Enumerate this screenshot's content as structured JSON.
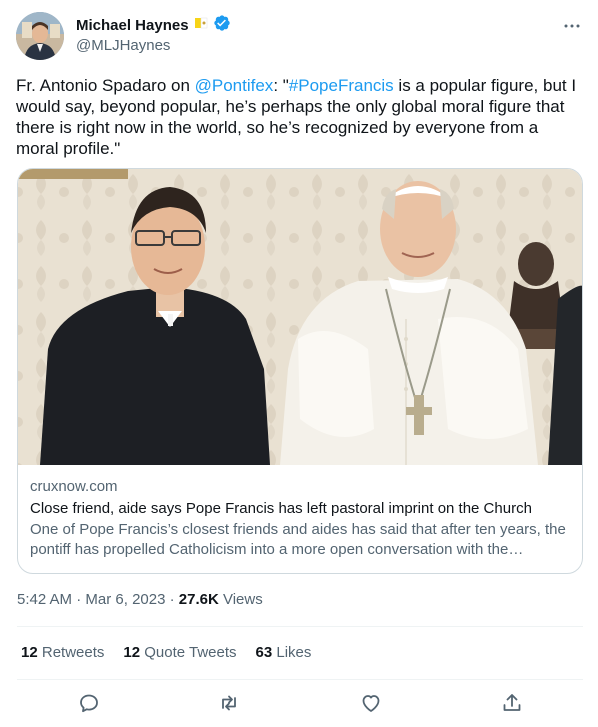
{
  "author": {
    "display_name": "Michael Haynes",
    "handle": "@MLJHaynes"
  },
  "tweet": {
    "text_before": "Fr. Antonio Spadaro on ",
    "mention": "@Pontifex",
    "text_middle": ": \"",
    "hashtag": "#PopeFrancis",
    "text_after": " is a popular figure, but I would say, beyond popular, he’s perhaps the only global moral figure that there is right now in the world, so he’s recognized by everyone from a moral profile.\""
  },
  "card": {
    "domain": "cruxnow.com",
    "title": "Close friend, aide says Pope Francis has left pastoral imprint on the Church",
    "description": "One of Pope Francis’s closest friends and aides has said that after ten years, the pontiff has propelled Catholicism into a more open conversation with the…"
  },
  "meta": {
    "time": "5:42 AM",
    "separator1": " · ",
    "date": "Mar 6, 2023",
    "separator2": " · ",
    "views_count": "27.6K",
    "views_label": " Views"
  },
  "stats": {
    "retweets_count": "12",
    "retweets_label": " Retweets",
    "quotes_count": "12",
    "quotes_label": " Quote Tweets",
    "likes_count": "63",
    "likes_label": " Likes"
  },
  "icons": {
    "badge": "vatican-flag-icon",
    "verified": "verified-badge-icon",
    "more": "more-options-icon",
    "reply": "reply-icon",
    "retweet": "retweet-icon",
    "like": "like-icon",
    "share": "share-icon"
  },
  "colors": {
    "link": "#1d9bf0",
    "secondary_text": "#536471",
    "border": "#cfd9de"
  }
}
